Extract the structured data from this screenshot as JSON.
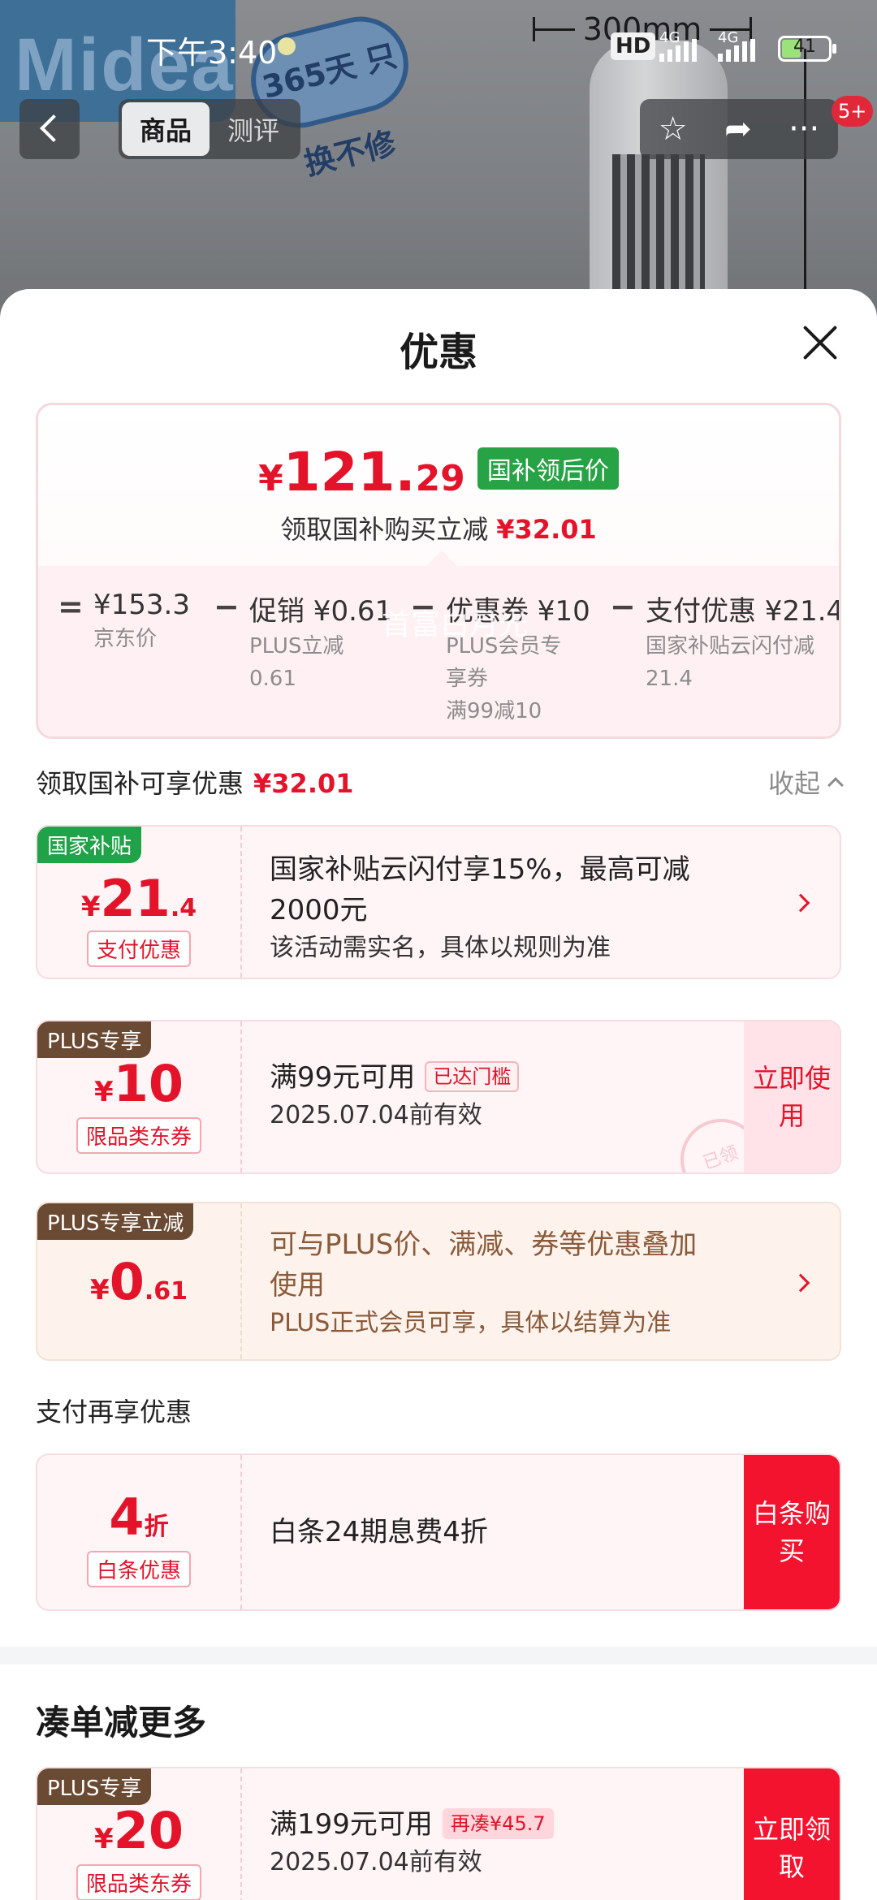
{
  "status_bar": {
    "time": "下午3:40",
    "hd": "HD",
    "network1": "4G",
    "network2": "4G",
    "battery": "41",
    "battery_level": 0.41
  },
  "hero": {
    "brand": "Midea",
    "badge_text": "365天 只换不修",
    "size_label": "300mm"
  },
  "nav": {
    "tabs": [
      {
        "label": "商品",
        "active": true
      },
      {
        "label": "测评",
        "active": false
      }
    ],
    "actions": [
      "star-icon",
      "share-icon",
      "more-icon"
    ],
    "more_symbol": "···",
    "badge": "5+"
  },
  "sheet": {
    "title": "优惠",
    "price": {
      "yen": "¥",
      "integer": "121.",
      "decimal": "29",
      "tag": "国补领后价",
      "sub_text": "领取国补购买立减",
      "sub_amount": "¥32.01"
    },
    "breakdown": [
      {
        "op": "=",
        "value": "¥153.3",
        "notes": [
          "京东价"
        ]
      },
      {
        "op": "−",
        "value": "促销 ¥0.61",
        "notes": [
          "PLUS立减",
          "0.61"
        ]
      },
      {
        "op": "−",
        "value": "优惠券 ¥10",
        "notes": [
          "PLUS会员专",
          "享券",
          "满99减10"
        ]
      },
      {
        "op": "−",
        "value": "支付优惠 ¥21.4",
        "notes": [
          "国家补贴云闪付减",
          "21.4"
        ]
      }
    ],
    "section1": {
      "label": "领取国补可享优惠",
      "amount": "¥32.01",
      "collapse": "收起"
    },
    "coupons": [
      {
        "corner": "国家补贴",
        "yen": "¥",
        "big": "21",
        "small": ".4",
        "kind": "支付优惠",
        "line1": "国家补贴云闪付享15%，最高可减",
        "line1b": "2000元",
        "line2": "该活动需实名，具体以规则为准"
      },
      {
        "corner": "PLUS专享",
        "yen": "¥",
        "big": "10",
        "small": "",
        "kind": "限品类东券",
        "line1": "满99元可用",
        "pill": "已达门槛",
        "line2": "2025.07.04前有效",
        "button": "立即使用",
        "stamp": "已领"
      },
      {
        "corner": "PLUS专享立减",
        "yen": "¥",
        "big": "0",
        "small": ".61",
        "kind": "",
        "line1": "可与PLUS价、满减、券等优惠叠加",
        "line1b": "使用",
        "line2": "PLUS正式会员可享，具体以结算为准"
      }
    ],
    "section2": {
      "label": "支付再享优惠"
    },
    "pay_coupon": {
      "big": "4",
      "small": "折",
      "kind": "白条优惠",
      "line1": "白条24期息费4折",
      "button": "白条购买"
    },
    "section3": {
      "label": "凑单减更多"
    },
    "more_coupon": {
      "corner": "PLUS专享",
      "yen": "¥",
      "big": "20",
      "kind": "限品类东券",
      "line1": "满199元可用",
      "pill": "再凑¥45.7",
      "line2": "2025.07.04前有效",
      "button": "立即领取"
    },
    "watermark": "首富白月光"
  },
  "colors": {
    "accent": "#e3132a",
    "green": "#1fa248",
    "plus_brown": "#6b4a33"
  }
}
